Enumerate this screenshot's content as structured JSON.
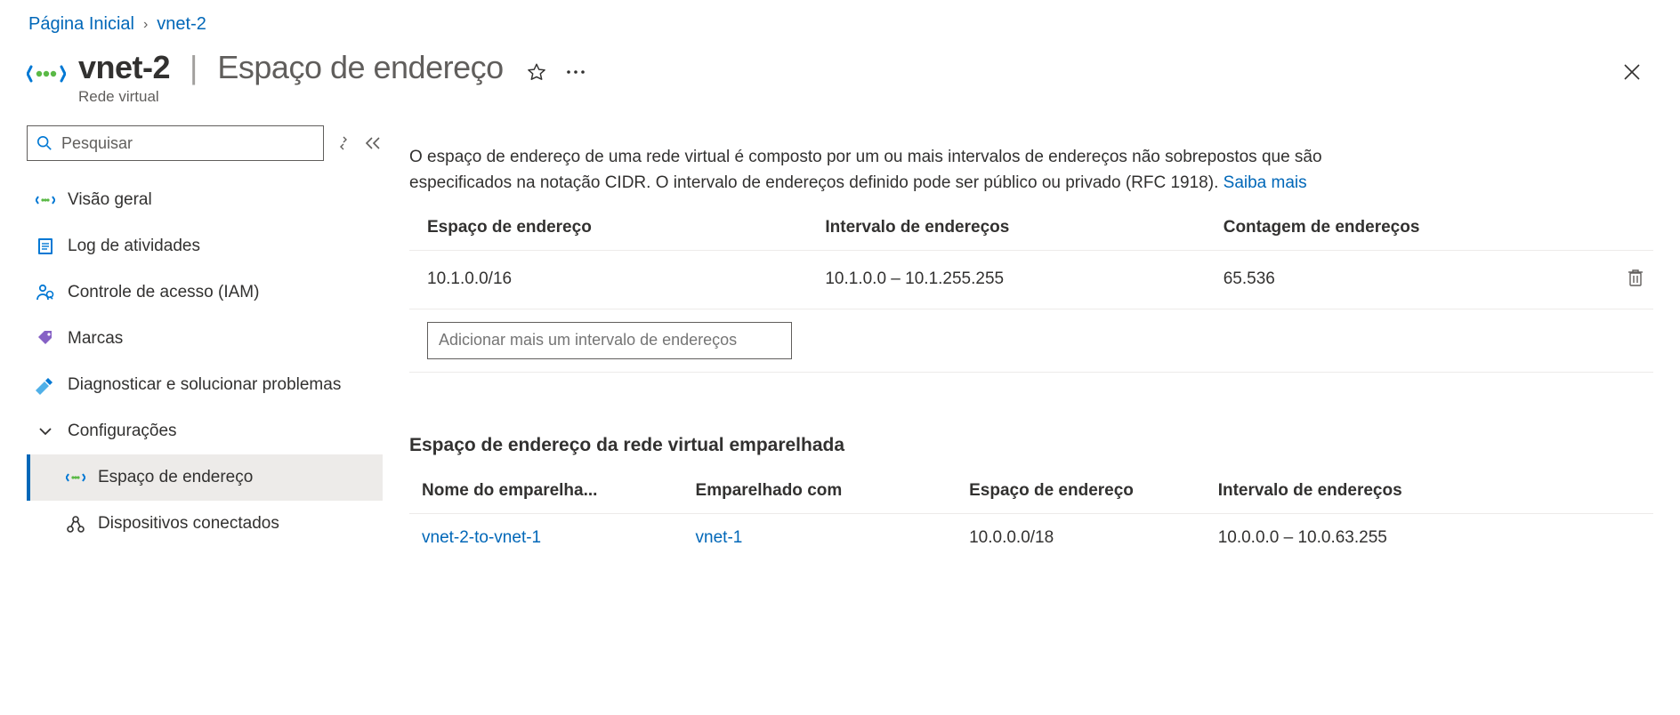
{
  "breadcrumb": {
    "home": "Página Inicial",
    "current": "vnet-2"
  },
  "header": {
    "resource_name": "vnet-2",
    "page_title": "Espaço de endereço",
    "resource_type": "Rede virtual"
  },
  "sidebar": {
    "search_placeholder": "Pesquisar",
    "items": [
      {
        "label": "Visão geral"
      },
      {
        "label": "Log de atividades"
      },
      {
        "label": "Controle de acesso (IAM)"
      },
      {
        "label": "Marcas"
      },
      {
        "label": "Diagnosticar e solucionar problemas"
      },
      {
        "label": "Configurações"
      },
      {
        "label": "Espaço de endereço"
      },
      {
        "label": "Dispositivos conectados"
      }
    ]
  },
  "main": {
    "intro_text": "O espaço de endereço de uma rede virtual é composto por um ou mais intervalos de endereços não sobrepostos que são especificados na notação CIDR. O intervalo de endereços definido pode ser público ou privado (RFC 1918). ",
    "learn_more": "Saiba mais",
    "address_table": {
      "headers": {
        "space": "Espaço de endereço",
        "range": "Intervalo de endereços",
        "count": "Contagem de endereços"
      },
      "rows": [
        {
          "space": "10.1.0.0/16",
          "range": "10.1.0.0 – 10.1.255.255",
          "count": "65.536"
        }
      ],
      "add_placeholder": "Adicionar mais um intervalo de endereços"
    },
    "peered_heading": "Espaço de endereço da rede virtual emparelhada",
    "peered_table": {
      "headers": {
        "name": "Nome do emparelha...",
        "with": "Emparelhado com",
        "space": "Espaço de endereço",
        "range": "Intervalo de endereços"
      },
      "rows": [
        {
          "name": "vnet-2-to-vnet-1",
          "with": "vnet-1",
          "space": "10.0.0.0/18",
          "range": "10.0.0.0 – 10.0.63.255"
        }
      ]
    }
  }
}
